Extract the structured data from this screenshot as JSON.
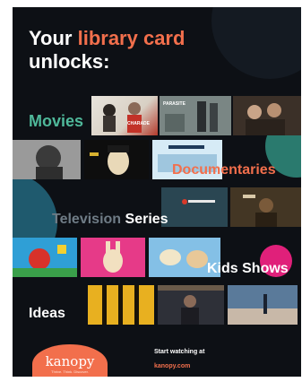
{
  "headline": {
    "line1_start": "Your ",
    "accent": "library card",
    "line2": "unlocks:"
  },
  "categories": {
    "movies": "Movies",
    "documentaries": "Documentaries",
    "tv_part1": "Television",
    "tv_part2": "Series",
    "kids": "Kids Shows",
    "ideas": "Ideas"
  },
  "film_labels": {
    "charade": "CHARADE",
    "parasite": "PARASITE"
  },
  "logo": {
    "name": "kanopy",
    "tagline": "Thrive. Think. Discover."
  },
  "footer": {
    "start": "Start watching at",
    "site": "kanopy.com"
  },
  "colors": {
    "accent": "#f26f4c",
    "movies": "#4fb89a",
    "background": "#0d1015",
    "kids_circle": "#e0207a"
  }
}
